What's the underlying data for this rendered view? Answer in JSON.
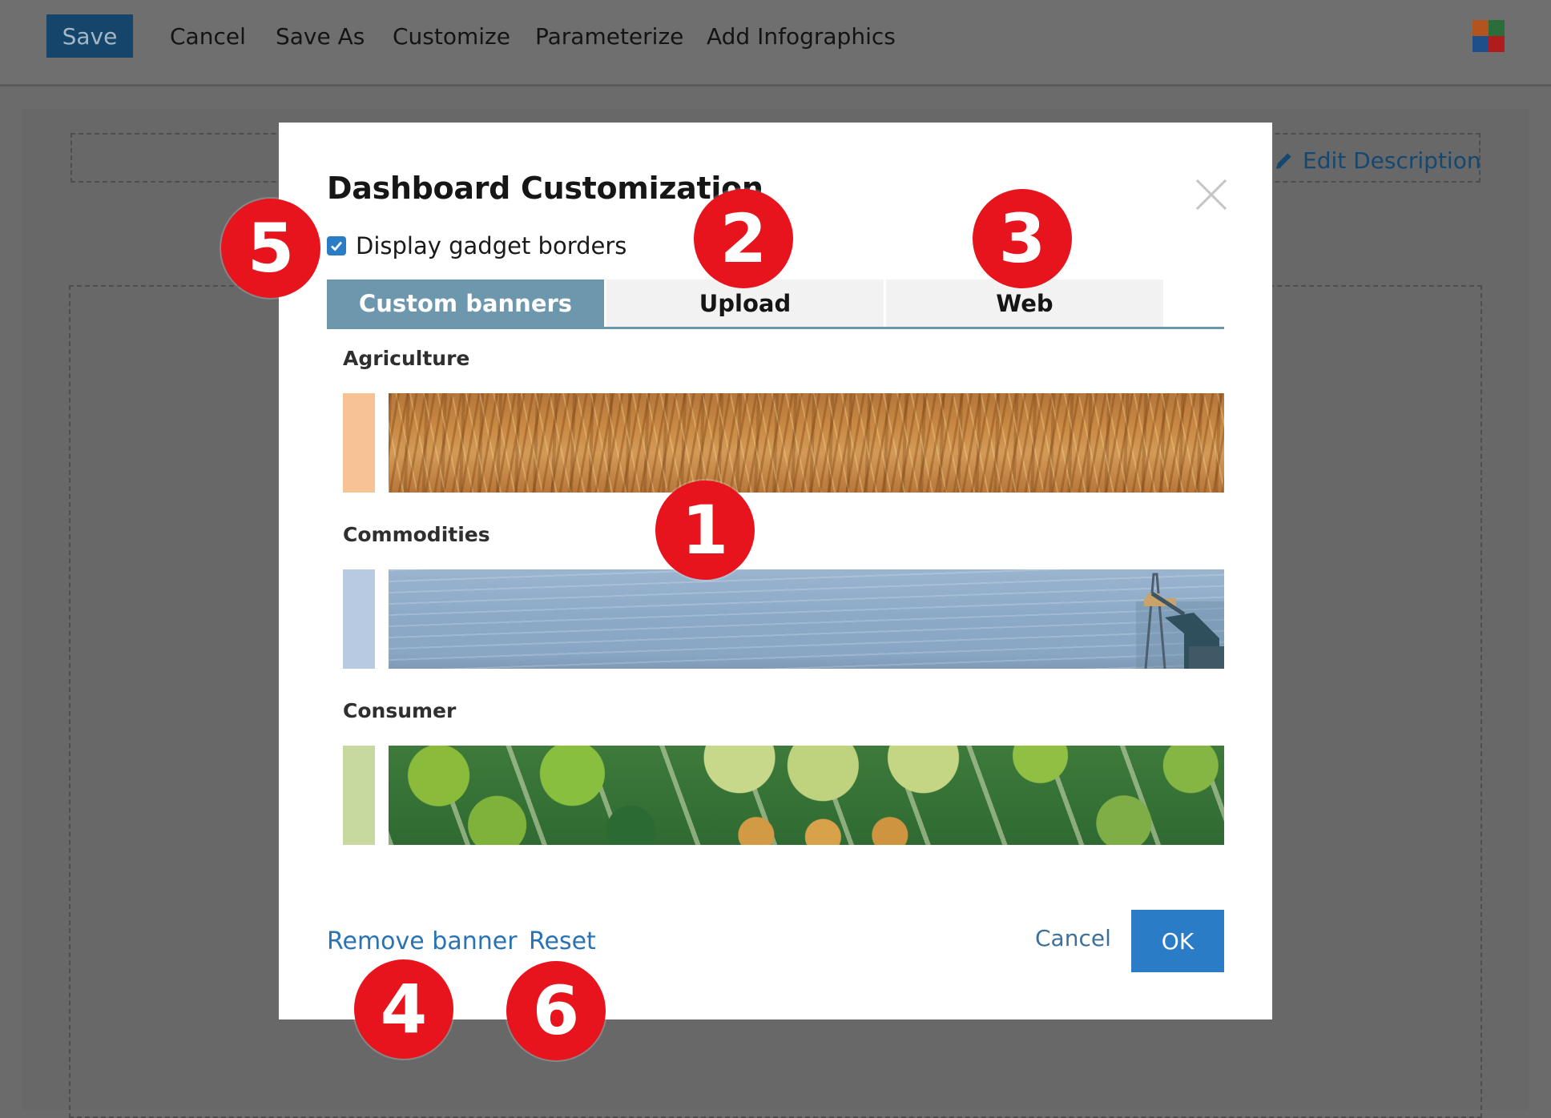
{
  "toolbar": {
    "save_label": "Save",
    "items": [
      "Cancel",
      "Save As",
      "Customize",
      "Parameterize",
      "Add Infographics"
    ],
    "logo_colors": [
      "#b3541e",
      "#2b6e3a",
      "#1f4f8a",
      "#b01c1c"
    ]
  },
  "background": {
    "edit_description": "Edit Description",
    "edit_icon": "pencil-icon"
  },
  "modal": {
    "title": "Dashboard Customization",
    "close_icon": "close-icon",
    "display_borders_label": "Display gadget borders",
    "display_borders_checked": true,
    "tabs": [
      {
        "label": "Custom banners",
        "active": true
      },
      {
        "label": "Upload",
        "active": false
      },
      {
        "label": "Web",
        "active": false
      }
    ],
    "categories": [
      {
        "label": "Agriculture",
        "swatch_color": "#f7c395",
        "banner": "wheat-field"
      },
      {
        "label": "Commodities",
        "swatch_color": "#b8c9e2",
        "banner": "oil-pump-sky"
      },
      {
        "label": "Consumer",
        "swatch_color": "#c8d9a0",
        "banner": "fruit-crates"
      }
    ],
    "remove_banner_label": "Remove banner",
    "reset_label": "Reset",
    "cancel_label": "Cancel",
    "ok_label": "OK"
  },
  "callouts": [
    "1",
    "2",
    "3",
    "4",
    "5",
    "6"
  ],
  "colors": {
    "accent_blue": "#2a7cc7",
    "tab_active": "#6c97ad",
    "callout_red": "#e8141d",
    "overlay_gray": "#6b6b6b"
  }
}
